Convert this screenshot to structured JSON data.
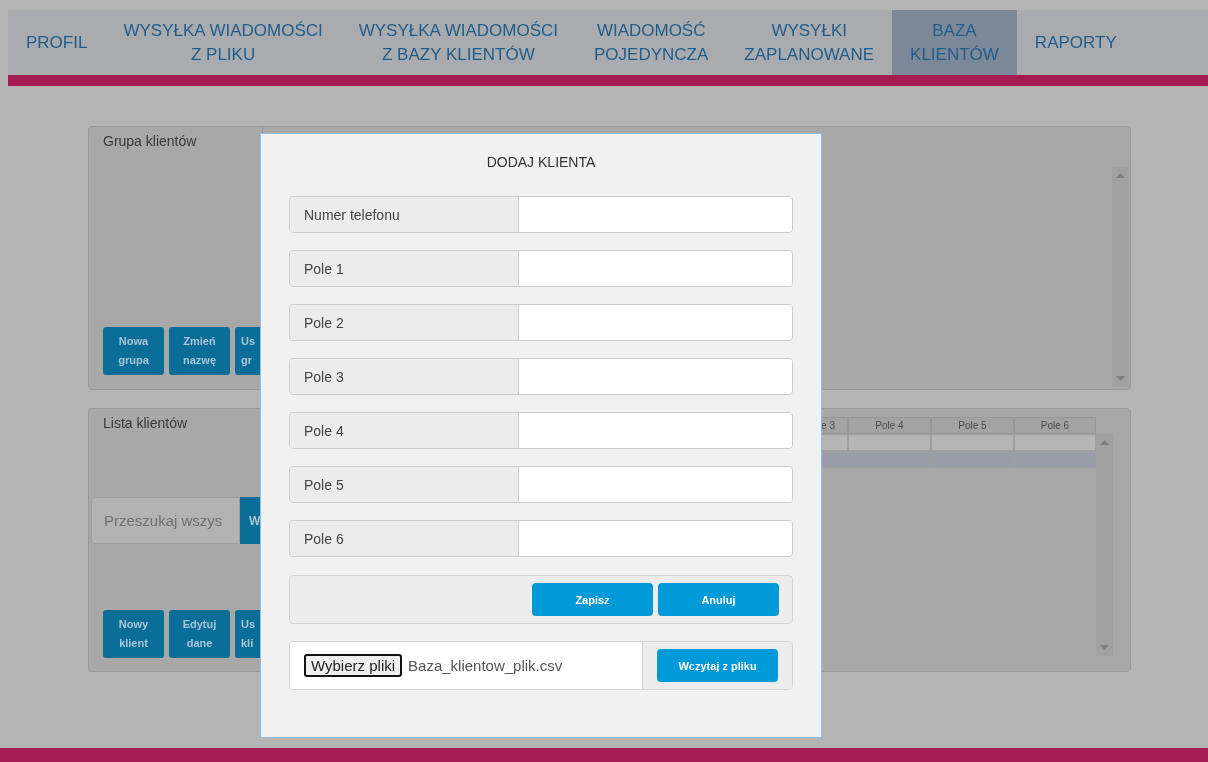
{
  "nav": {
    "tabs": [
      {
        "label": "PROFIL",
        "selected": false
      },
      {
        "label": "WYSYŁKA WIADOMOŚCI\nZ PLIKU",
        "selected": false
      },
      {
        "label": "WYSYŁKA WIADOMOŚCI\nZ BAZY KLIENTÓW",
        "selected": false
      },
      {
        "label": "WIADOMOŚĆ\nPOJEDYNCZA",
        "selected": false
      },
      {
        "label": "WYSYŁKI\nZAPLANOWANE",
        "selected": false
      },
      {
        "label": "BAZA\nKLIENTÓW",
        "selected": true
      },
      {
        "label": "RAPORTY",
        "selected": false
      }
    ]
  },
  "group_panel": {
    "title": "Grupa klientów",
    "buttons": [
      "Nowa\ngrupa",
      "Zmień\nnazwę",
      "Us\ngr"
    ]
  },
  "client_panel": {
    "title": "Lista klientów",
    "search": {
      "placeholder": "Przeszukaj wszys",
      "button": "W"
    },
    "buttons": [
      "Nowy\nklient",
      "Edytuj\ndane",
      "Us\nkli"
    ],
    "table": {
      "columns": [
        "e 3",
        "Pole 4",
        "Pole 5",
        "Pole 6"
      ],
      "rows": [
        {
          "selected": false
        },
        {
          "selected": true
        }
      ]
    }
  },
  "dialog": {
    "title": "DODAJ KLIENTA",
    "fields": [
      {
        "label": "Numer telefonu"
      },
      {
        "label": "Pole 1"
      },
      {
        "label": "Pole 2"
      },
      {
        "label": "Pole 3"
      },
      {
        "label": "Pole 4"
      },
      {
        "label": "Pole 5"
      },
      {
        "label": "Pole 6"
      }
    ],
    "buttons": [
      "Zapisz",
      "Anuluj"
    ],
    "file": {
      "choose_button": "Wybierz pliki",
      "file_name": "Baza_klientow_plik.csv",
      "load_button": "Wczytaj z pliku"
    }
  }
}
